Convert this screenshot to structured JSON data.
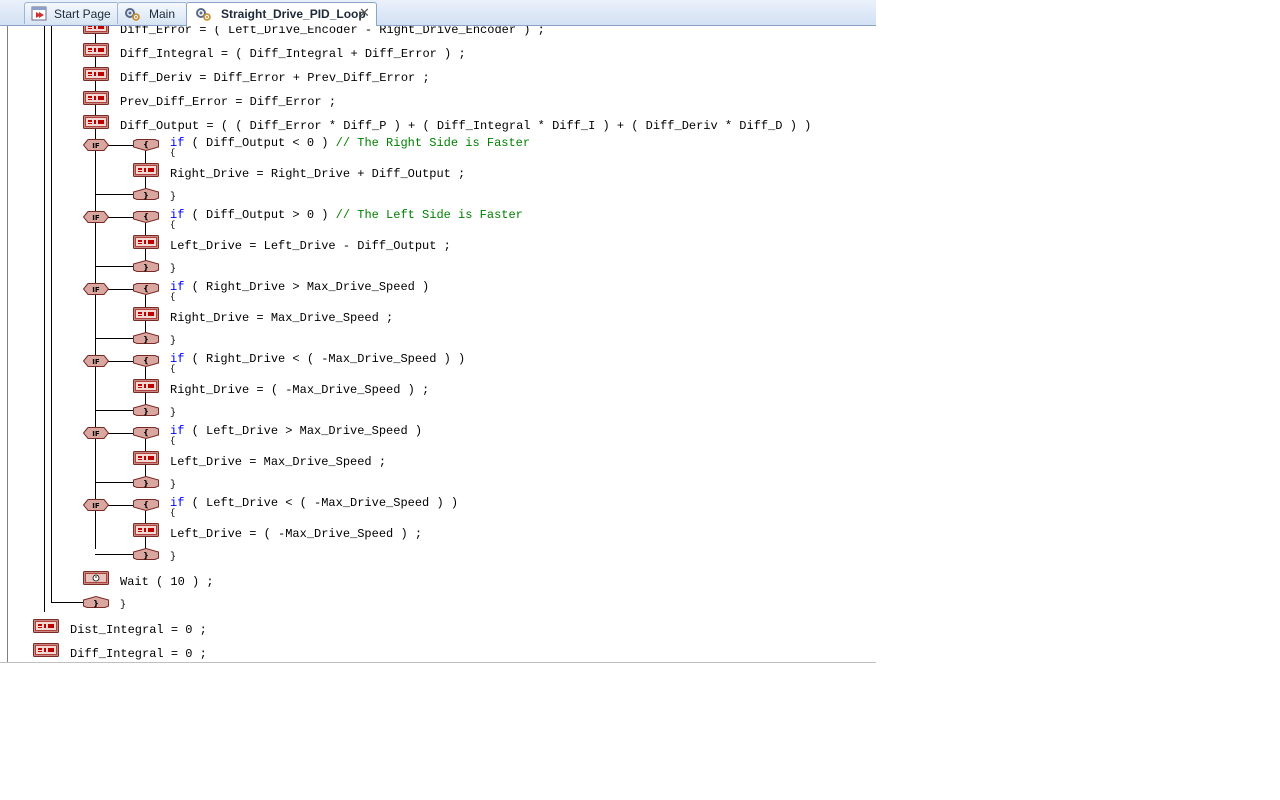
{
  "tabs": [
    {
      "label": "Start Page",
      "icon": "start-page-icon",
      "active": false
    },
    {
      "label": "Main",
      "icon": "program-icon",
      "active": false
    },
    {
      "label": "Straight_Drive_PID_Loop",
      "icon": "program-icon",
      "active": true,
      "close": "✕"
    }
  ],
  "code": {
    "l01": "Diff_Error = ( Left_Drive_Encoder - Right_Drive_Encoder ) ;",
    "l02": "Diff_Integral = ( Diff_Integral + Diff_Error ) ;",
    "l03": "Diff_Deriv = Diff_Error + Prev_Diff_Error ;",
    "l04": "Prev_Diff_Error = Diff_Error ;",
    "l05": "Diff_Output = ( ( Diff_Error * Diff_P ) + ( Diff_Integral * Diff_I ) + ( Diff_Deriv * Diff_D ) )",
    "if1_kw": "if",
    "if1": " ( Diff_Output < 0 ) ",
    "if1_comment": "// The Right Side is Faster",
    "ob1": "{",
    "b1": "Right_Drive = Right_Drive + Diff_Output ;",
    "cb1": "}",
    "if2_kw": "if",
    "if2": " ( Diff_Output > 0 ) ",
    "if2_comment": "// The Left Side is Faster",
    "ob2": "{",
    "b2": "Left_Drive = Left_Drive - Diff_Output ;",
    "cb2": "}",
    "if3_kw": "if",
    "if3": " ( Right_Drive > Max_Drive_Speed )",
    "ob3": "{",
    "b3": "Right_Drive = Max_Drive_Speed ;",
    "cb3": "}",
    "if4_kw": "if",
    "if4": " ( Right_Drive < ( -Max_Drive_Speed ) )",
    "ob4": "{",
    "b4": "Right_Drive = ( -Max_Drive_Speed ) ;",
    "cb4": "}",
    "if5_kw": "if",
    "if5": " ( Left_Drive > Max_Drive_Speed )",
    "ob5": "{",
    "b5": "Left_Drive = Max_Drive_Speed ;",
    "cb5": "}",
    "if6_kw": "if",
    "if6": " ( Left_Drive < ( -Max_Drive_Speed ) )",
    "ob6": "{",
    "b6": "Left_Drive = ( -Max_Drive_Speed ) ;",
    "cb6": "}",
    "wait": "Wait ( 10 ) ;",
    "loop_close": "}",
    "l20": "Dist_Integral = 0 ;",
    "l21": "Diff_Integral = 0 ;"
  },
  "block_icons": {
    "assign": "assignment-block-icon",
    "if": "if-block-icon",
    "open": "open-brace-block-icon",
    "close": "close-brace-block-icon",
    "wait": "wait-block-icon"
  },
  "colors": {
    "keyword": "#0000ff",
    "comment": "#008000",
    "block_fill": "#d9a6a0",
    "block_border": "#c0504d"
  }
}
